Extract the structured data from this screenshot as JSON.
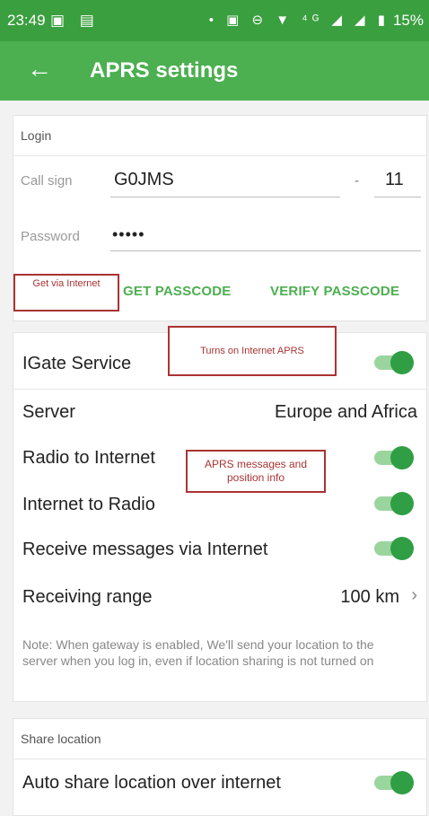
{
  "status_bar": {
    "time": "23:49",
    "left_icons": "▣ ▤",
    "right_icons": "• ▣ ⊖ ▼ ⁴ᴳ ◢ ◢ ▮",
    "battery": "15%"
  },
  "app_bar": {
    "back_icon": "←",
    "title": "APRS settings"
  },
  "login": {
    "header": "Login",
    "call_sign_label": "Call sign",
    "call_sign_value": "G0JMS",
    "dash": "-",
    "ssid_value": "11",
    "password_label": "Password",
    "password_value": "•••••",
    "get_passcode": "GET PASSCODE",
    "verify_passcode": "VERIFY PASSCODE"
  },
  "annotations": {
    "get_via_internet": "Get via Internet",
    "turns_on": "Turns on Internet APRS",
    "aprs_messages": "APRS messages and position info"
  },
  "igate": {
    "igate_service": "IGate Service",
    "server_label": "Server",
    "server_value": "Europe and Africa",
    "radio_to_internet": "Radio to Internet",
    "internet_to_radio": "Internet to Radio",
    "receive_messages": "Receive messages via Internet",
    "receiving_range_label": "Receiving range",
    "receiving_range_value": "100 km",
    "chevron": "›",
    "note": "Note: When gateway is enabled, We'll send your location to the server when you log in, even if location sharing is not turned on"
  },
  "share": {
    "header": "Share location",
    "auto_share": "Auto share location over internet"
  },
  "toggles": {
    "igate_service": true,
    "radio_to_internet": true,
    "internet_to_radio": true,
    "receive_messages": true,
    "auto_share": true
  },
  "colors": {
    "status_bar": "#3a9f3f",
    "app_bar": "#4caf50",
    "accent": "#4caf50",
    "toggle_on": "#2f9e44",
    "annotation": "#aa3333"
  }
}
